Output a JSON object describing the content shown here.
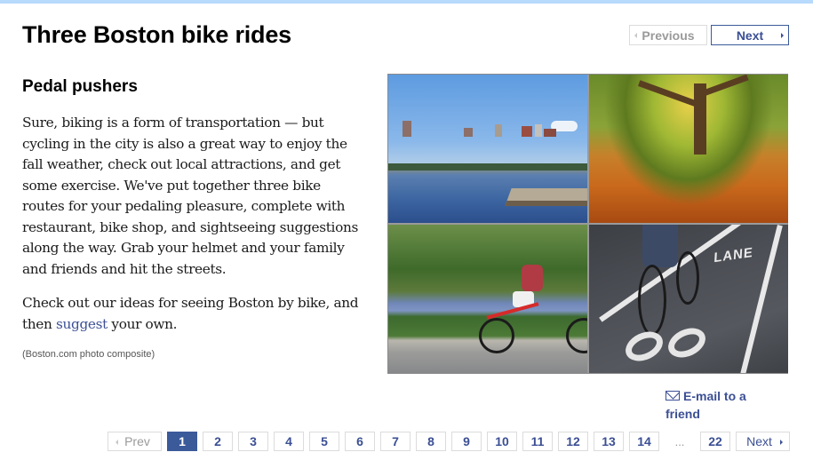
{
  "header": {
    "title": "Three Boston bike rides",
    "previous_label": "Previous",
    "next_label": "Next"
  },
  "article": {
    "subheading": "Pedal pushers",
    "paragraph1": "Sure, biking is a form of transportation — but cycling in the city is also a great way to enjoy the fall weather, check out local attractions, and get some exercise. We've put together three bike routes for your pedaling pleasure, complete with restaurant, bike shop, and sightseeing suggestions along the way. Grab your helmet and your family and friends and hit the streets.",
    "paragraph2_before_link": "Check out our ideas for seeing Boston by bike, and then ",
    "paragraph2_link": "suggest",
    "paragraph2_after_link": " your own.",
    "photo_credit": "(Boston.com photo composite)"
  },
  "photos": [
    {
      "description": "Charles River skyline with dock"
    },
    {
      "description": "Autumn tree with fallen orange leaves"
    },
    {
      "description": "Cyclist on riverside path"
    },
    {
      "description": "Cyclist in bike lane",
      "road_text": "LANE"
    }
  ],
  "share": {
    "icon": "envelope-icon",
    "label": "E-mail to a friend"
  },
  "pagination": {
    "prev_label": "Prev",
    "pages": [
      "1",
      "2",
      "3",
      "4",
      "5",
      "6",
      "7",
      "8",
      "9",
      "10",
      "11",
      "12",
      "13",
      "14"
    ],
    "current_page": "1",
    "ellipsis": "...",
    "last_page": "22",
    "next_label": "Next"
  },
  "colors": {
    "accent": "#3b4f94",
    "active_page_bg": "#3b5a9a",
    "top_bar": "#b8dafc",
    "disabled_text": "#9a9a9a"
  }
}
